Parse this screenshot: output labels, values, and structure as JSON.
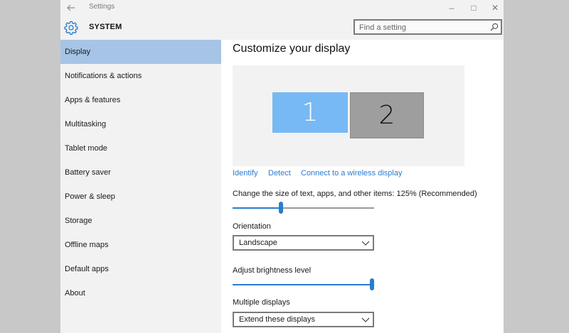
{
  "titlebar": {
    "back_icon": "back-arrow-icon",
    "title": "Settings",
    "minimize": "–",
    "maximize": "□",
    "close": "✕"
  },
  "header": {
    "icon": "gear-icon",
    "title": "SYSTEM",
    "search_placeholder": "Find a setting"
  },
  "sidebar": {
    "items": [
      {
        "label": "Display",
        "selected": true
      },
      {
        "label": "Notifications & actions"
      },
      {
        "label": "Apps & features"
      },
      {
        "label": "Multitasking"
      },
      {
        "label": "Tablet mode"
      },
      {
        "label": "Battery saver"
      },
      {
        "label": "Power & sleep"
      },
      {
        "label": "Storage"
      },
      {
        "label": "Offline maps"
      },
      {
        "label": "Default apps"
      },
      {
        "label": "About"
      }
    ]
  },
  "main": {
    "title": "Customize your display",
    "monitors": [
      "1",
      "2"
    ],
    "links": {
      "identify": "Identify",
      "detect": "Detect",
      "wireless": "Connect to a wireless display"
    },
    "scale": {
      "label": "Change the size of text, apps, and other items: 125% (Recommended)",
      "position": 0.34
    },
    "orientation": {
      "label": "Orientation",
      "value": "Landscape"
    },
    "brightness": {
      "label": "Adjust brightness level",
      "position": 1.0
    },
    "multiple_displays": {
      "label": "Multiple displays",
      "value": "Extend these displays"
    }
  },
  "colors": {
    "accent": "#2a7bd0",
    "selected_nav": "#a6c4e6",
    "monitor_1": "#76b9f4",
    "monitor_2": "#9e9e9e"
  }
}
